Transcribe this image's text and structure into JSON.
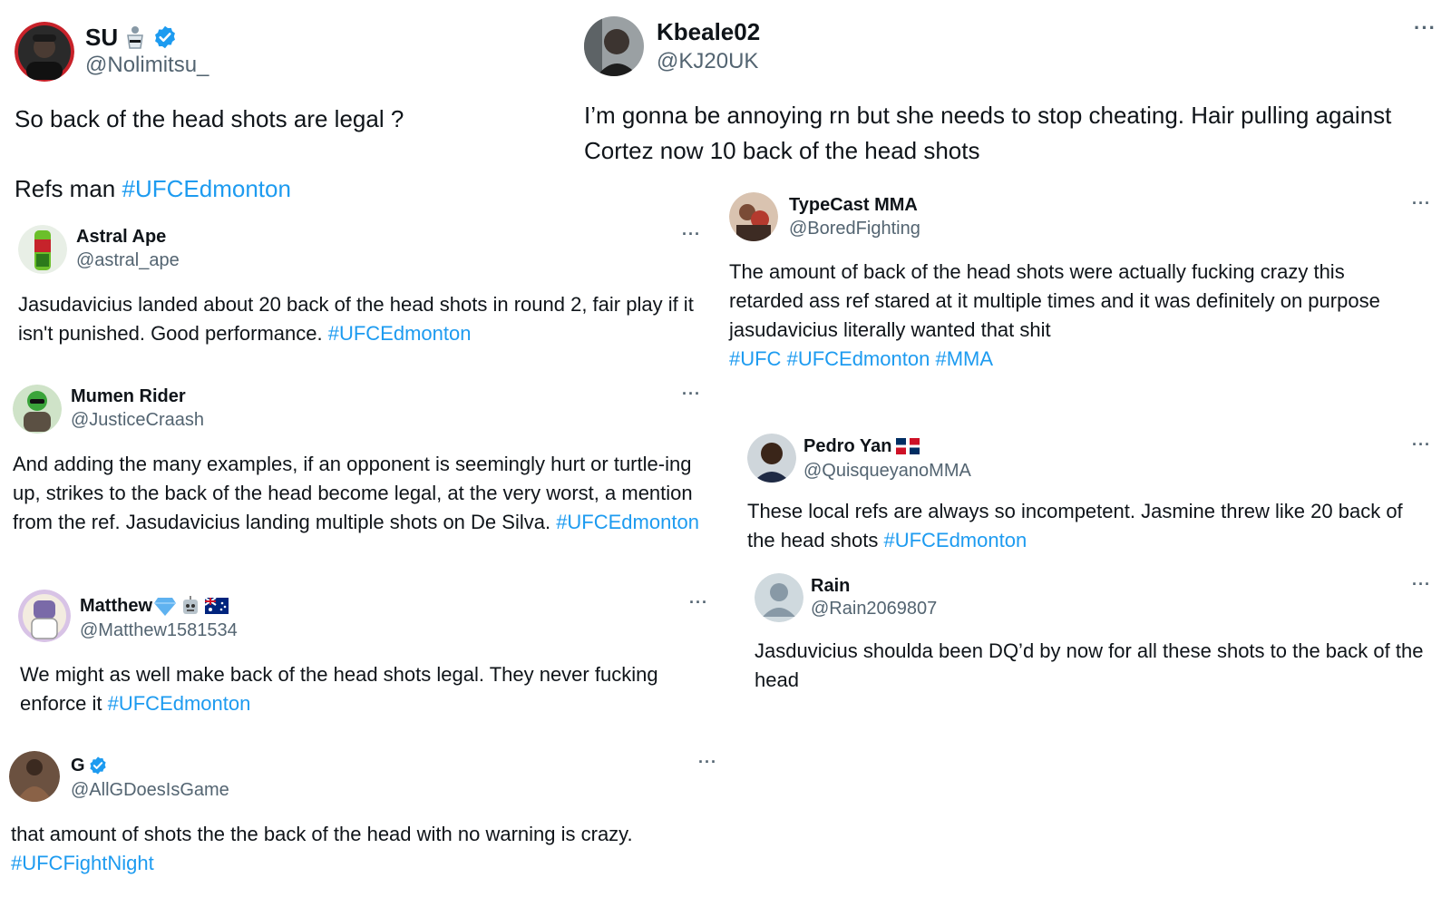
{
  "tweets": {
    "su": {
      "name": "SU",
      "handle": "@Nolimitsu_",
      "text_line1": "So back of the head shots are legal ?",
      "text_line2": "Refs man ",
      "hashtags": [
        "#UFCEdmonton"
      ]
    },
    "kbeale": {
      "name": "Kbeale02",
      "handle": "@KJ20UK",
      "text": "I’m gonna be annoying rn but she needs to stop cheating. Hair pulling against Cortez now 10 back of the head shots",
      "more": "···"
    },
    "astral": {
      "name": "Astral Ape",
      "handle": "@astral_ape",
      "text": "Jasudavicius landed about 20 back of the head shots in round 2, fair play if it isn't punished. Good performance. ",
      "hashtags": [
        "#UFCEdmonton"
      ],
      "more": "···"
    },
    "typecast": {
      "name": "TypeCast MMA",
      "handle": "@BoredFighting",
      "text": "The amount of back of the head shots were actually fucking crazy this retarded ass ref stared at it multiple times and it was definitely on purpose jasudavicius literally wanted that shit",
      "hashtags": [
        "#UFC",
        "#UFCEdmonton",
        "#MMA"
      ],
      "more": "···"
    },
    "mumen": {
      "name": "Mumen Rider",
      "handle": "@JusticeCraash",
      "text": "And adding the many examples, if an opponent is seemingly hurt or turtle-ing up, strikes to the back of the head become legal, at the very worst, a mention from the ref. Jasudavicius landing multiple shots on De Silva. ",
      "hashtags": [
        "#UFCEdmonton"
      ],
      "more": "···"
    },
    "pedro": {
      "name": "Pedro Yan",
      "handle": "@QuisqueyanoMMA",
      "text": "These local refs are always so incompetent. Jasmine threw like 20 back of the head shots ",
      "hashtags": [
        "#UFCEdmonton"
      ],
      "more": "···"
    },
    "matthew": {
      "name": "Matthew",
      "handle": "@Matthew1581534",
      "text": "We might as well make back of the head shots legal. They never fucking enforce it ",
      "hashtags": [
        "#UFCEdmonton"
      ],
      "more": "···"
    },
    "rain": {
      "name": "Rain",
      "handle": "@Rain2069807",
      "text": "Jasduvicius shoulda been DQ’d by now for all these shots to the back of the head",
      "more": "···"
    },
    "g": {
      "name": "G",
      "handle": "@AllGDoesIsGame",
      "text": "that amount of shots the the back of the head with no warning is crazy.",
      "hashtags": [
        "#UFCFightNight"
      ],
      "more": "···"
    }
  },
  "colors": {
    "text": "#0f1419",
    "handle": "#536471",
    "hashtag": "#1d9bf0",
    "verified": "#1d9bf0"
  },
  "icons": {
    "verified": "verified-badge-icon",
    "more": "more-options-icon",
    "flag_dr": "dominican-flag-icon",
    "flag_au": "australia-flag-icon",
    "gem": "gem-emoji-icon",
    "robot": "robot-emoji-icon",
    "karate": "karate-emoji-icon",
    "default_avatar": "default-avatar-icon"
  }
}
